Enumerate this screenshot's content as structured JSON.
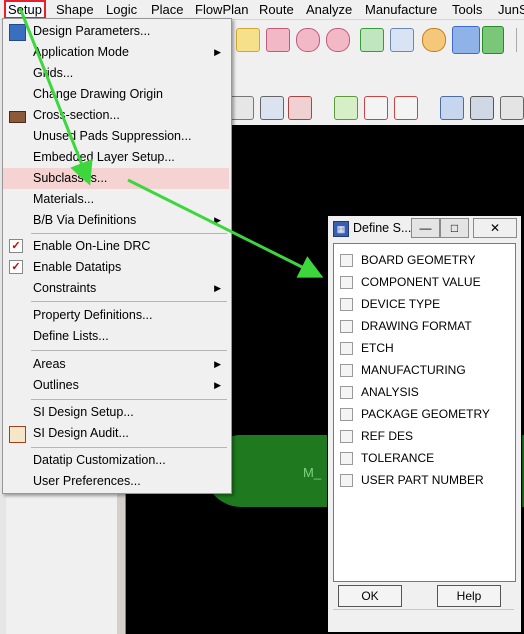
{
  "menubar": {
    "items": [
      "Setup",
      "Shape",
      "Logic",
      "Place",
      "FlowPlan",
      "Route",
      "Analyze",
      "Manufacture",
      "Tools",
      "JunS"
    ]
  },
  "setup_menu": {
    "items": [
      {
        "label": "Design Parameters...",
        "submenu": false
      },
      {
        "label": "Application Mode",
        "submenu": true
      },
      {
        "label": "Grids...",
        "submenu": false
      },
      {
        "label": "Change Drawing Origin",
        "submenu": false
      },
      {
        "label": "Cross-section...",
        "submenu": false
      },
      {
        "label": "Unused Pads Suppression...",
        "submenu": false
      },
      {
        "label": "Embedded Layer Setup...",
        "submenu": false
      },
      {
        "label": "Subclasses...",
        "submenu": false,
        "highlighted": true
      },
      {
        "label": "Materials...",
        "submenu": false
      },
      {
        "label": "B/B Via Definitions",
        "submenu": true
      },
      {
        "label": "Enable On-Line DRC",
        "submenu": false,
        "checked": true
      },
      {
        "label": "Enable Datatips",
        "submenu": false,
        "checked": true
      },
      {
        "label": "Constraints",
        "submenu": true
      },
      {
        "label": "Property Definitions...",
        "submenu": false
      },
      {
        "label": "Define Lists...",
        "submenu": false
      },
      {
        "label": "Areas",
        "submenu": true
      },
      {
        "label": "Outlines",
        "submenu": true
      },
      {
        "label": "SI Design Setup...",
        "submenu": false
      },
      {
        "label": "SI Design Audit...",
        "submenu": false
      },
      {
        "label": "Datatip Customization...",
        "submenu": false
      },
      {
        "label": "User Preferences...",
        "submenu": false
      }
    ]
  },
  "dialog": {
    "title": "Define S...",
    "classes": [
      "BOARD GEOMETRY",
      "COMPONENT VALUE",
      "DEVICE TYPE",
      "DRAWING FORMAT",
      "ETCH",
      "MANUFACTURING",
      "ANALYSIS",
      "PACKAGE GEOMETRY",
      "REF DES",
      "TOLERANCE",
      "USER PART NUMBER"
    ],
    "ok_label": "OK",
    "help_label": "Help"
  },
  "canvas": {
    "label": "M_"
  },
  "colors": {
    "highlight": "#f6d3d3",
    "annotation_arrow": "#3dd63d",
    "canvas_bg": "#000000",
    "shape_green": "#1f7a1f"
  }
}
